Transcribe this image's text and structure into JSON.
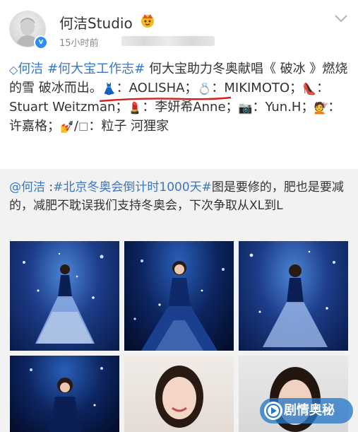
{
  "header": {
    "name": "何洁Studio",
    "time": "15小时前"
  },
  "post": {
    "tag_person": "何洁",
    "tag_topic": "#何大宝工作志#",
    "text1": "何大宝助力冬奥献唱《 破冰 》燃烧的雪 破冰而出。",
    "credit_dress": "：AOLISHA；",
    "credit_ring": "：MIKIMOTO；",
    "credit_shoes": "：Stuart Weitzman；",
    "credit_makeup": "：李妍希Anne；",
    "credit_photo": "：Yun.H；",
    "credit_hair": "：许嘉格；",
    "credit_nails_sep": "/",
    "credit_nails": "：粒子 河狸家"
  },
  "repost": {
    "user": "@何洁",
    "topic": "#北京冬奥会倒计时1000天#",
    "text": "图是要修的，肥也是要减的，减肥不耽误我们支持冬奥会，下次争取从XL到L"
  },
  "watermark": {
    "label": "剧情奥秘"
  },
  "icons": {
    "avatar": "statue-avatar",
    "verified": "verified-badge-icon",
    "crown": "crown-emoji-icon",
    "chevron": "chevron-down-icon",
    "dress": "dress-emoji",
    "ring": "ring-emoji",
    "shoe": "high-heel-emoji",
    "lipstick": "lipstick-emoji",
    "camera": "camera-emoji",
    "haircut": "haircut-emoji",
    "nail": "nail-polish-emoji"
  },
  "colors": {
    "link": "#3a77c2",
    "repost_bg": "#f2f2f2",
    "watermark": "#2878c8"
  }
}
